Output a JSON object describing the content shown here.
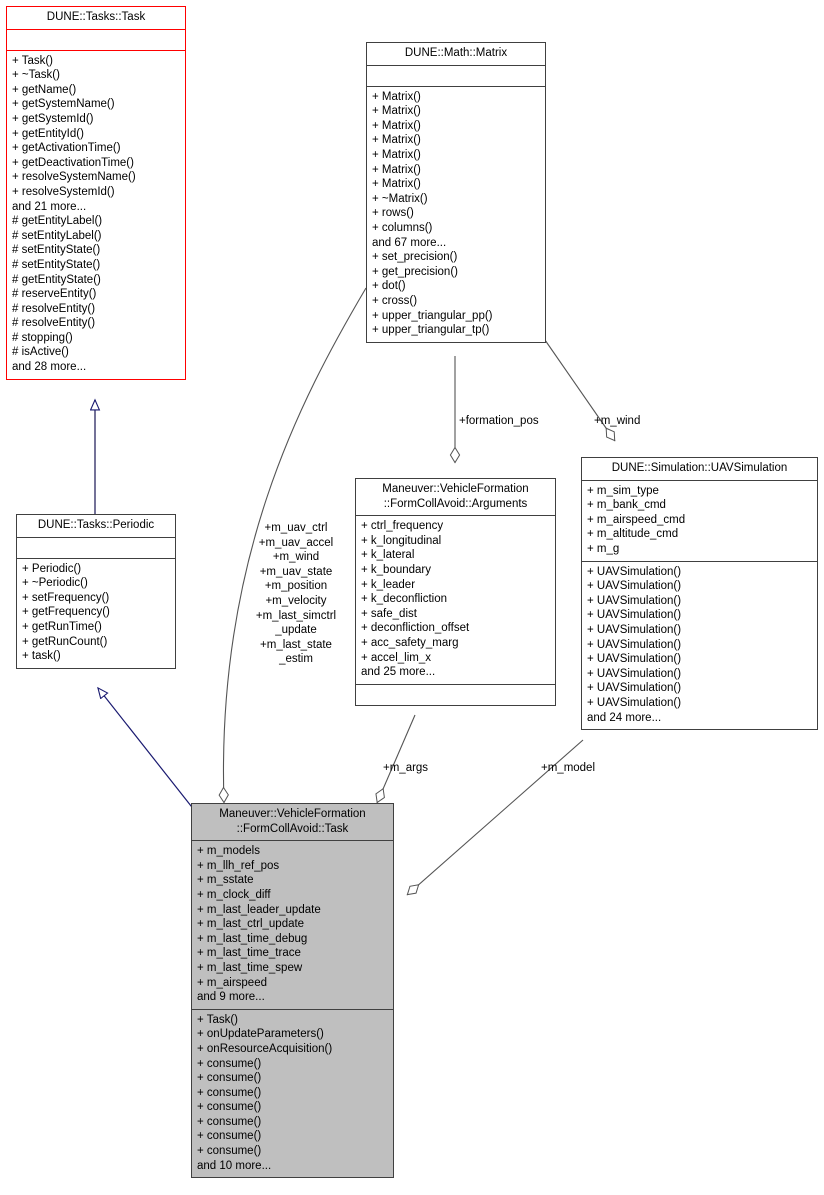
{
  "diagram": {
    "type": "uml-collaboration-diagram",
    "colors": {
      "highlight_border": "#ff0000",
      "node_border": "#404040",
      "node_fill": "#ffffff",
      "focus_fill": "#bfbfbf",
      "inherit_edge": "#191970",
      "assoc_edge": "#545454"
    }
  },
  "nodes": {
    "dune_tasks_task": {
      "title": "DUNE::Tasks::Task",
      "attributes": [],
      "operations": [
        "+ Task()",
        "+ ~Task()",
        "+ getName()",
        "+ getSystemName()",
        "+ getSystemId()",
        "+ getEntityId()",
        "+ getActivationTime()",
        "+ getDeactivationTime()",
        "+ resolveSystemName()",
        "+ resolveSystemId()",
        "and 21 more...",
        "# getEntityLabel()",
        "# setEntityLabel()",
        "# setEntityState()",
        "# setEntityState()",
        "# getEntityState()",
        "# reserveEntity()",
        "# resolveEntity()",
        "# resolveEntity()",
        "# stopping()",
        "# isActive()",
        "and 28 more..."
      ]
    },
    "dune_math_matrix": {
      "title": "DUNE::Math::Matrix",
      "attributes": [],
      "operations": [
        "+ Matrix()",
        "+ Matrix()",
        "+ Matrix()",
        "+ Matrix()",
        "+ Matrix()",
        "+ Matrix()",
        "+ Matrix()",
        "+ ~Matrix()",
        "+ rows()",
        "+ columns()",
        "and 67 more...",
        "+ set_precision()",
        "+ get_precision()",
        "+ dot()",
        "+ cross()",
        "+ upper_triangular_pp()",
        "+ upper_triangular_tp()"
      ]
    },
    "dune_tasks_periodic": {
      "title": "DUNE::Tasks::Periodic",
      "attributes": [],
      "operations": [
        "+ Periodic()",
        "+ ~Periodic()",
        "+ setFrequency()",
        "+ getFrequency()",
        "+ getRunTime()",
        "+ getRunCount()",
        "+ task()"
      ]
    },
    "formcollavoid_arguments": {
      "title": "Maneuver::VehicleFormation\n::FormCollAvoid::Arguments",
      "attributes": [
        "+ ctrl_frequency",
        "+ k_longitudinal",
        "+ k_lateral",
        "+ k_boundary",
        "+ k_leader",
        "+ k_deconfliction",
        "+ safe_dist",
        "+ deconfliction_offset",
        "+ acc_safety_marg",
        "+ accel_lim_x",
        "and 25 more..."
      ],
      "operations": []
    },
    "uav_simulation": {
      "title": "DUNE::Simulation::UAVSimulation",
      "attributes": [
        "+ m_sim_type",
        "+ m_bank_cmd",
        "+ m_airspeed_cmd",
        "+ m_altitude_cmd",
        "+ m_g"
      ],
      "operations": [
        "+ UAVSimulation()",
        "+ UAVSimulation()",
        "+ UAVSimulation()",
        "+ UAVSimulation()",
        "+ UAVSimulation()",
        "+ UAVSimulation()",
        "+ UAVSimulation()",
        "+ UAVSimulation()",
        "+ UAVSimulation()",
        "+ UAVSimulation()",
        "and 24 more..."
      ]
    },
    "formcollavoid_task": {
      "title": "Maneuver::VehicleFormation\n::FormCollAvoid::Task",
      "attributes": [
        "+ m_models",
        "+ m_llh_ref_pos",
        "+ m_sstate",
        "+ m_clock_diff",
        "+ m_last_leader_update",
        "+ m_last_ctrl_update",
        "+ m_last_time_debug",
        "+ m_last_time_trace",
        "+ m_last_time_spew",
        "+ m_airspeed",
        "and 9 more..."
      ],
      "operations": [
        "+ Task()",
        "+ onUpdateParameters()",
        "+ onResourceAcquisition()",
        "+ consume()",
        "+ consume()",
        "+ consume()",
        "+ consume()",
        "+ consume()",
        "+ consume()",
        "+ consume()",
        "and 10 more..."
      ]
    }
  },
  "edge_labels": {
    "matrix_to_task": "+m_uav_ctrl\n+m_uav_accel\n+m_wind\n+m_uav_state\n+m_position\n+m_velocity\n+m_last_simctrl\n_update\n+m_last_state\n_estim",
    "matrix_to_arguments": "+formation_pos",
    "matrix_to_uavsim": "+m_wind",
    "arguments_to_task": "+m_args",
    "uavsim_to_task": "+m_model"
  }
}
